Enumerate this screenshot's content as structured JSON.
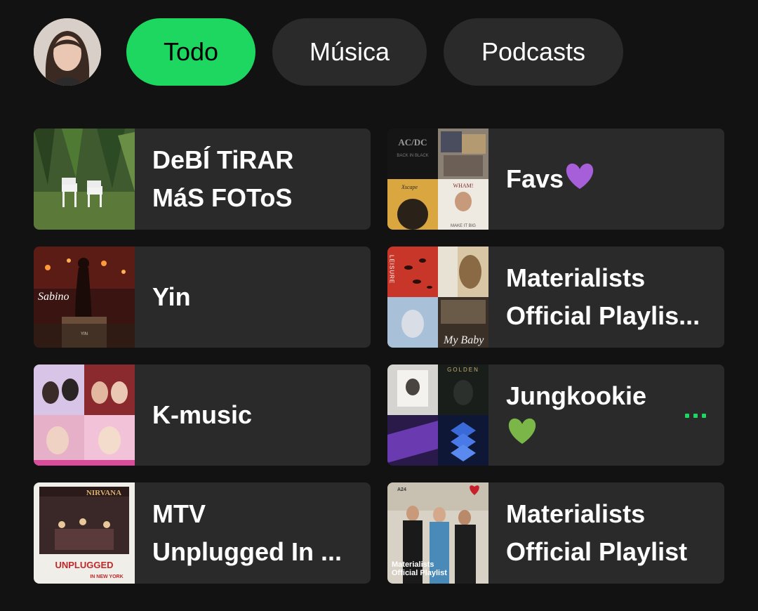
{
  "filters": {
    "todo": "Todo",
    "musica": "Música",
    "podcasts": "Podcasts"
  },
  "items": [
    {
      "title": "DeBÍ TiRAR\nMáS FOToS"
    },
    {
      "title": "Favs"
    },
    {
      "title": "Yin"
    },
    {
      "title": "Materialists\nOfficial Playlis..."
    },
    {
      "title": "K-music"
    },
    {
      "title": "Jungkookie\n"
    },
    {
      "title": "MTV\nUnplugged In ..."
    },
    {
      "title": "Materialists\nOfficial Playlist"
    }
  ],
  "covers": {
    "acdc": "AC/DC",
    "back_in_black": "BACK IN BLACK",
    "wham": "WHAM!",
    "make_it_big": "MAKE IT BIG",
    "xscape": "Xscape",
    "leisure": "LEISURE",
    "my_baby": "My Baby",
    "sabino": "Sabino",
    "yin": "YIN",
    "golden": "GOLDEN",
    "nirvana": "NIRVANA",
    "unplugged": "UNPLUGGED",
    "in_new_york": "IN NEW YORK",
    "a24": "A24",
    "materialists_cover": "Materialists\nOfficial Playlist"
  },
  "colors": {
    "accent": "#1ed760",
    "background": "#121212",
    "card": "#2a2a2a",
    "heart_purple": "#a65fd8",
    "heart_green": "#7ab648"
  }
}
